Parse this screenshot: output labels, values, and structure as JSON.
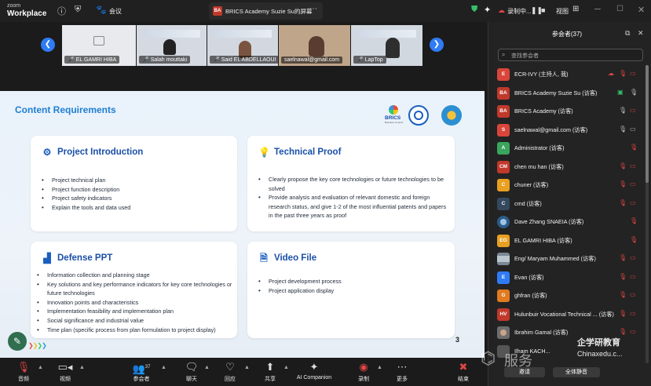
{
  "app": {
    "brand_small": "zoom",
    "brand_big": "Workplace",
    "meeting_label": "会议",
    "share_tab_badge": "BA",
    "share_tab_label": "BRICS Academy Suzie Su的屏幕",
    "recording_label": "录制中...",
    "view_label": "视图"
  },
  "video_strip": {
    "tiles": [
      {
        "name": "EL GAMRI HIBA",
        "muted": true
      },
      {
        "name": "Salah mouttaki",
        "muted": true
      },
      {
        "name": "Said EL ABDELLAOUI",
        "muted": true
      },
      {
        "name": "saelnawal@gmail.com",
        "muted": false
      },
      {
        "name": "LapTop",
        "muted": true
      }
    ]
  },
  "slide": {
    "title": "Content Requirements",
    "logo_text": "BRICS",
    "logo_subtext": "Business Council",
    "page_number": "3",
    "cards": [
      {
        "title": "Project Introduction",
        "icon": "network-icon",
        "items": [
          "Project technical plan",
          "Project function description",
          "Project safety indicators",
          "Explain the tools and data used"
        ]
      },
      {
        "title": "Technical Proof",
        "icon": "lightbulb-icon",
        "items": [
          "Clearly propose the key core technologies or future technologies to be solved",
          "Provide analysis and evaluation of relevant domestic and foreign research status, and give 1-2 of the most influential patents and papers in the past three years as proof"
        ]
      },
      {
        "title": "Defense PPT",
        "icon": "chart-icon",
        "items": [
          "Information collection and planning stage",
          "Key solutions and key performance indicators for key core technologies or future technologies",
          "Innovation points and characteristics",
          "Implementation feasibility and implementation plan",
          "Social significance and industrial value",
          "Time plan (specific process from plan formulation to project display)"
        ]
      },
      {
        "title": "Video File",
        "icon": "video-file-icon",
        "items": [
          "Project development process",
          "Project application display"
        ]
      }
    ]
  },
  "toolbar": {
    "items": [
      {
        "label": "音频",
        "icon": "mic-off-icon"
      },
      {
        "label": "视频",
        "icon": "camera-icon"
      },
      {
        "label": "参会者",
        "icon": "participants-icon",
        "count": "37"
      },
      {
        "label": "聊天",
        "icon": "chat-icon"
      },
      {
        "label": "回应",
        "icon": "heart-icon"
      },
      {
        "label": "共享",
        "icon": "share-icon"
      },
      {
        "label": "AI Companion",
        "icon": "sparkle-icon"
      },
      {
        "label": "录制",
        "icon": "record-icon"
      },
      {
        "label": "更多",
        "icon": "more-icon"
      },
      {
        "label": "结束",
        "icon": "end-icon"
      }
    ]
  },
  "participants": {
    "title": "参会者(37)",
    "search_placeholder": "查找参会者",
    "invite_label": "邀请",
    "mute_all_label": "全体静音",
    "list": [
      {
        "initials": "E",
        "color": "#d9453b",
        "name": "ECR-IVY (主持人, 我)"
      },
      {
        "initials": "BA",
        "color": "#c0392b",
        "name": "BRICS Academy Suzie Su (访客)"
      },
      {
        "initials": "BA",
        "color": "#c0392b",
        "name": "BRICS Academy (访客)"
      },
      {
        "initials": "S",
        "color": "#d9453b",
        "name": "saelnawal@gmail.com (访客)"
      },
      {
        "initials": "A",
        "color": "#3aa55c",
        "name": "Administrator (访客)"
      },
      {
        "initials": "CM",
        "color": "#c0392b",
        "name": "chen mu han (访客)"
      },
      {
        "initials": "C",
        "color": "#e8a020",
        "name": "chuner (访客)"
      },
      {
        "initials": "C",
        "color": "#34495e",
        "name": "cmd (访客)"
      },
      {
        "initials": "",
        "color": "#2c5d8a",
        "name": "Dave Zhang SNAEIA (访客)"
      },
      {
        "initials": "EG",
        "color": "#e8a020",
        "name": "EL GAMRI HIBA (访客)"
      },
      {
        "initials": "",
        "color": "#7a8894",
        "name": "Eng/ Maryam Muhammed (访客)"
      },
      {
        "initials": "E",
        "color": "#2f7bf5",
        "name": "Evan (访客)"
      },
      {
        "initials": "G",
        "color": "#e07b20",
        "name": "ghfran (访客)"
      },
      {
        "initials": "HV",
        "color": "#c0392b",
        "name": "Hulunbuir Vocational Technical ... (访客)"
      },
      {
        "initials": "",
        "color": "#6d6d6d",
        "name": "Ibrahim Gamal (访客)"
      },
      {
        "initials": "",
        "color": "#555555",
        "name": "Ilham KACH..."
      }
    ]
  },
  "watermark": {
    "text1": "服务",
    "text2": "企学研教育",
    "text3": "Chinaxedu.c..."
  }
}
